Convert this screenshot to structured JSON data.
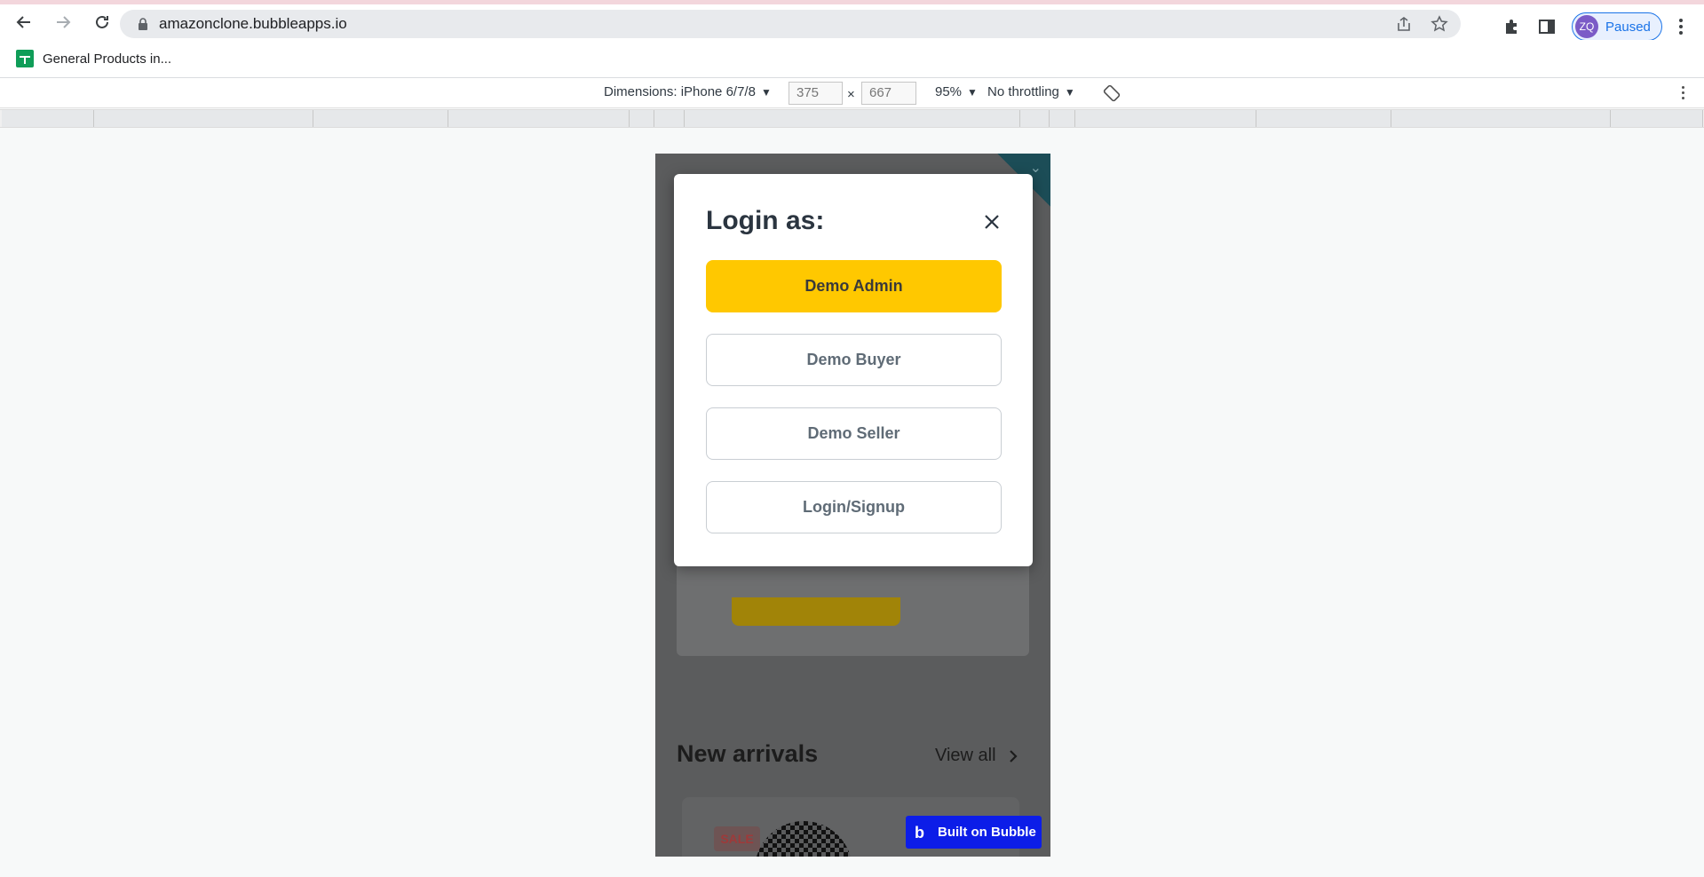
{
  "browser": {
    "url": "amazonclone.bubbleapps.io",
    "profile": {
      "initials": "ZQ",
      "status": "Paused"
    },
    "bookmarks": [
      {
        "label": "General Products in..."
      }
    ]
  },
  "devtools": {
    "dimensions_label": "Dimensions: iPhone 6/7/8",
    "width": "375",
    "height": "667",
    "times": "×",
    "zoom": "95%",
    "throttling": "No throttling"
  },
  "modal": {
    "title": "Login as:",
    "buttons": [
      {
        "label": "Demo Admin",
        "style": "primary"
      },
      {
        "label": "Demo Buyer",
        "style": "outline"
      },
      {
        "label": "Demo Seller",
        "style": "outline"
      },
      {
        "label": "Login/Signup",
        "style": "outline"
      }
    ]
  },
  "page": {
    "section_title": "New arrivals",
    "view_all": "View all",
    "sale_badge": "SALE",
    "built_on_bubble": "Built on Bubble"
  },
  "colors": {
    "primary_button": "#ffc800",
    "bubble_badge": "#0c1de8",
    "profile_accent": "#1a73e8"
  }
}
